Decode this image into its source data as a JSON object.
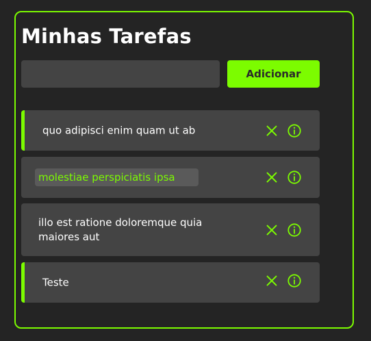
{
  "app": {
    "title": "Minhas Tarefas"
  },
  "add_form": {
    "input_value": "",
    "input_placeholder": "",
    "button_label": "Adicionar"
  },
  "tasks": [
    {
      "text": "quo adipisci enim quam ut ab",
      "completed": true,
      "editing": false
    },
    {
      "text": "molestiae perspiciatis ipsa",
      "completed": false,
      "editing": true
    },
    {
      "text": "illo est ratione doloremque quia maiores aut",
      "completed": false,
      "editing": false
    },
    {
      "text": "Teste",
      "completed": true,
      "editing": false
    }
  ],
  "icons": {
    "delete": "close-icon",
    "info": "info-icon"
  },
  "colors": {
    "accent": "#7cfc00",
    "background": "#242424",
    "card": "#444444",
    "text": "#ffffff"
  }
}
